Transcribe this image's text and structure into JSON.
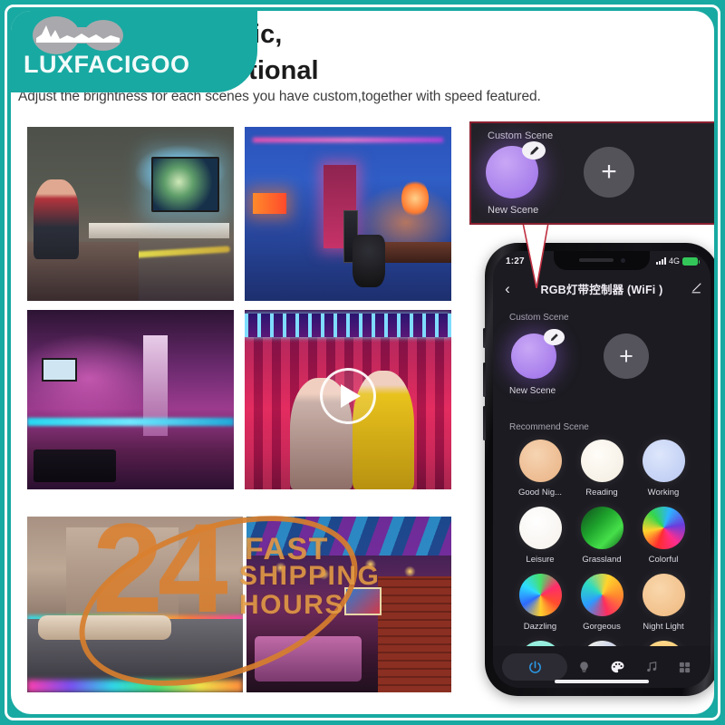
{
  "brand": {
    "name": "LUXFACIGOO",
    "badge_color": "#18a9a2",
    "logo_icon": "soundwave-logo-icon"
  },
  "headline": {
    "line1": "e with Static,",
    "line2": "Modes Optional"
  },
  "subheadline": "Adjust the brightness for each scenes you have custom,together with speed featured.",
  "collage": {
    "photos": [
      {
        "id": "photo-living-room-tv",
        "caption": "Living room with TV and LED strip lighting"
      },
      {
        "id": "photo-blue-studio",
        "caption": "Blue lit studio room with speakers and desk"
      },
      {
        "id": "photo-pink-lounge",
        "caption": "Pink and purple lit bar lounge"
      },
      {
        "id": "photo-party-dancers",
        "caption": "Party scene with dancers (video thumbnail)"
      },
      {
        "id": "photo-bedroom",
        "caption": "Bedroom with RGB accent lighting"
      },
      {
        "id": "photo-club-interior",
        "caption": "Club interior with colorful ceiling lights"
      }
    ],
    "play_button": "play-icon"
  },
  "shipping_badge": {
    "number": "24",
    "word1": "FAST",
    "word2": "SHIPPING",
    "word3": "HOURS",
    "color": "#d98030"
  },
  "callout": {
    "border_color": "#8a2030",
    "section_label": "Custom Scene",
    "scene_name": "New Scene",
    "edit_icon": "pencil-icon",
    "add_icon": "plus-icon",
    "add_label": "+"
  },
  "phone": {
    "status_bar": {
      "time": "1:27",
      "network": "4G",
      "signal_icon": "signal-bars-icon",
      "battery_icon": "battery-icon",
      "battery_color": "#33c75a"
    },
    "app_bar": {
      "back_icon": "chevron-left-icon",
      "title": "RGB灯带控制器 (WiFi )",
      "edit_icon": "pencil-edit-icon"
    },
    "custom_scene": {
      "label": "Custom Scene",
      "scene_name": "New Scene",
      "edit_icon": "pencil-icon",
      "add_label": "+"
    },
    "recommend": {
      "label": "Recommend Scene",
      "scenes": [
        {
          "name": "Good Nig...",
          "swatch": "radial-gradient(circle at 40% 35%, #f6d4b2, #e9b183)"
        },
        {
          "name": "Reading",
          "swatch": "radial-gradient(circle at 40% 35%, #fffdf8, #f3ece0)"
        },
        {
          "name": "Working",
          "swatch": "radial-gradient(circle at 40% 35%, #dde6fb, #b9c8f2)"
        },
        {
          "name": "Leisure",
          "swatch": "radial-gradient(circle at 40% 35%, #ffffff, #f5f0ea)"
        },
        {
          "name": "Grassland",
          "swatch": "linear-gradient(135deg, #0f4a1c 0%, #1ea32c 40%, #46e04a 70%, #0c5a18 100%)"
        },
        {
          "name": "Colorful",
          "swatch": "conic-gradient(from 200deg, #ff2d2d, #ffd32d, #34d64a, #2db4ff, #6a3ddd, #ff2d8e, #ff2d2d)"
        },
        {
          "name": "Dazzling",
          "swatch": "conic-gradient(from 120deg, #ff4d2d, #ffd02d, #2d6aff, #2ddcff, #46e06a, #ff2d6a, #ff4d2d)"
        },
        {
          "name": "Gorgeous",
          "swatch": "conic-gradient(from 20deg, #ffd42d, #ff8a2d, #ff2d5e, #2d9aff, #2ddcc0, #ffd42d)"
        },
        {
          "name": "Night Light",
          "swatch": "radial-gradient(circle at 40% 35%, #f9d7ac, #efb87e)"
        }
      ],
      "partial_row": [
        {
          "name": "",
          "swatch": "linear-gradient(180deg, #9ef0e0, #2fd8d0)"
        },
        {
          "name": "",
          "swatch": "linear-gradient(135deg, #fdfbe8, #cfd6ea 40%, #f0dd6a 100%)"
        },
        {
          "name": "",
          "swatch": "linear-gradient(180deg, #ffd98a, #ff9a3a)"
        }
      ]
    },
    "tabbar": {
      "items": [
        {
          "icon": "power-icon",
          "active": true
        },
        {
          "icon": "bulb-icon",
          "active": false
        },
        {
          "icon": "palette-icon",
          "active": false
        },
        {
          "icon": "music-note-icon",
          "active": false
        },
        {
          "icon": "grid-icon",
          "active": false
        }
      ],
      "active_color": "#2b9ae8"
    }
  }
}
